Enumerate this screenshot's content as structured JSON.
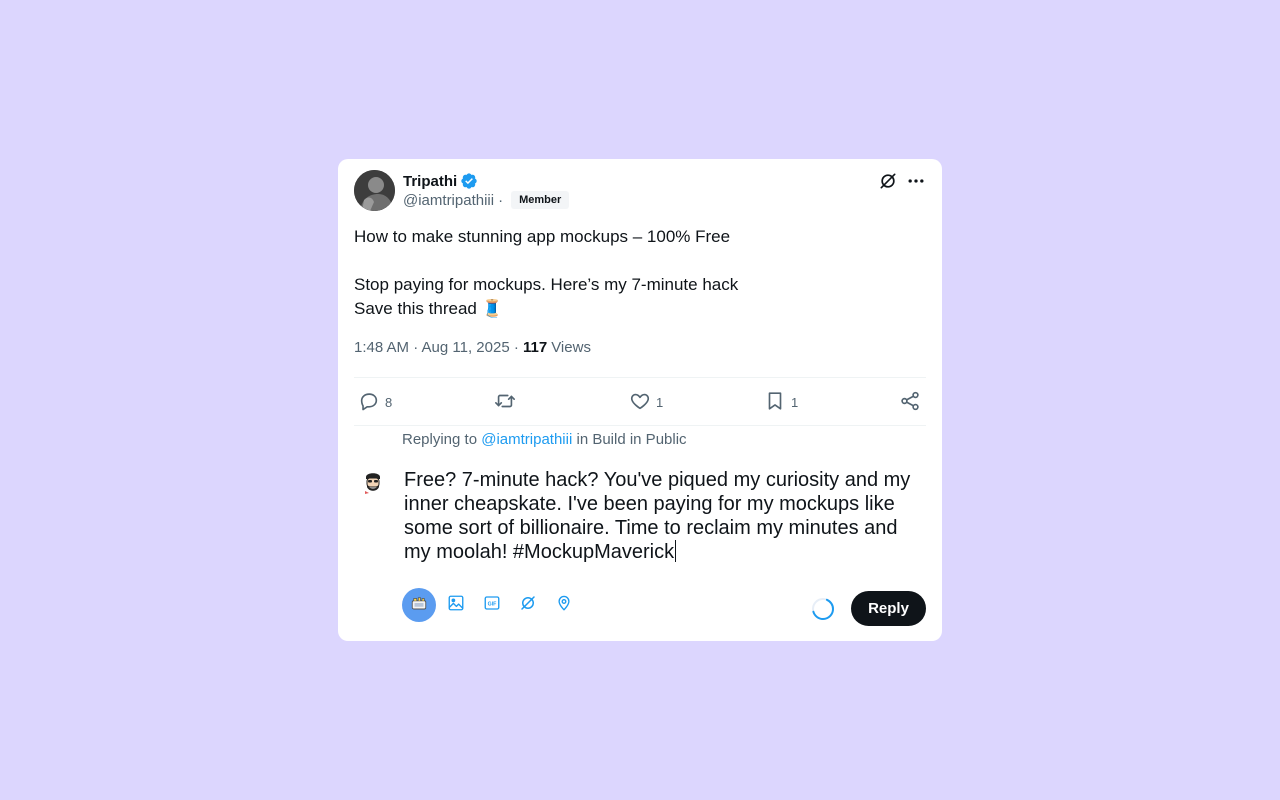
{
  "tweet": {
    "author": {
      "display_name": "Tripathi",
      "handle": "@iamtripathiii",
      "badge": "Member",
      "verified": true,
      "verified_color": "#1d9bf0"
    },
    "text_line1": "How to make stunning app mockups – 100% Free",
    "text_line2": "Stop paying for mockups. Here’s my 7-minute hack",
    "text_line3": "Save this thread",
    "text_emoji": "🧵",
    "time": "1:48 AM · Aug 11, 2025 · ",
    "views_count": "117",
    "views_label": "Views"
  },
  "actions": {
    "reply_count": "8",
    "retweet_count": "",
    "like_count": "1",
    "bookmark_count": "1"
  },
  "reply": {
    "replying_prefix": "Replying to ",
    "replying_handle": "@iamtripathiii",
    "replying_in": " in Build in Public",
    "draft_text": "Free? 7-minute hack? You've piqued my curiosity and my inner cheapskate. I've been paying for my mockups like some sort of billionaire. Time to reclaim my minutes and my moolah! #MockupMaverick",
    "button_label": "Reply",
    "gif_label": "GIF"
  },
  "colors": {
    "background": "#dcd6fe",
    "accent": "#1d9bf0",
    "reply_button": "#0f1419",
    "active_tool": "#5b9cf0"
  },
  "icons": [
    "verified-badge-icon",
    "grok-icon",
    "more-icon",
    "reply-icon",
    "retweet-icon",
    "like-icon",
    "bookmark-icon",
    "share-icon",
    "ai-assist-icon",
    "image-icon",
    "gif-icon",
    "grok-icon",
    "location-icon"
  ]
}
